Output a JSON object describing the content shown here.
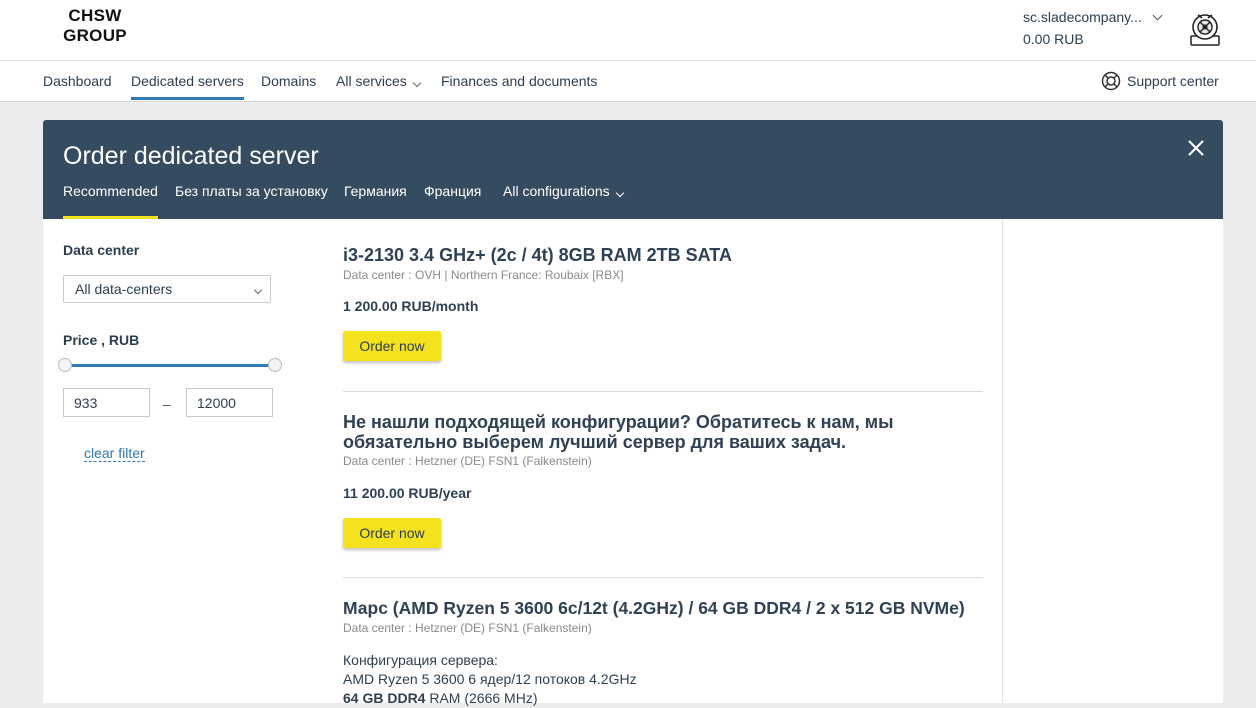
{
  "header": {
    "logo_line1": "CHSW",
    "logo_line2": "GROUP",
    "account_name": "sc.sladecompany...",
    "balance": "0.00 RUB"
  },
  "nav": {
    "items": [
      "Dashboard",
      "Dedicated servers",
      "Domains",
      "All services",
      "Finances and documents"
    ],
    "active": "Dedicated servers",
    "support": "Support center"
  },
  "panel": {
    "title": "Order dedicated server",
    "tabs": [
      "Recommended",
      "Без платы за установку",
      "Германия",
      "Франция",
      "All configurations"
    ],
    "active_tab": "Recommended"
  },
  "filters": {
    "datacenter_label": "Data center",
    "datacenter_value": "All data-centers",
    "price_label": "Price , RUB",
    "price_min": "933",
    "price_sep": "–",
    "price_max": "12000",
    "clear": "clear filter"
  },
  "offers": [
    {
      "title": "i3-2130 3.4 GHz+ (2c / 4t) 8GB RAM 2TB SATA",
      "dc": "Data center : OVH | Northern France: Roubaix [RBX]",
      "price": "1 200.00 RUB/month",
      "button": "Order now"
    },
    {
      "title": "Не нашли подходящей конфигурации? Обратитесь к нам, мы обязательно выберем лучший сервер для ваших задач.",
      "dc": "Data center : Hetzner (DE) FSN1 (Falkenstein)",
      "price": "11 200.00 RUB/year",
      "button": "Order now"
    },
    {
      "title": "Марс (AMD Ryzen 5 3600 6c/12t (4.2GHz) / 64 GB DDR4 / 2 x 512 GB NVMe)",
      "dc": "Data center : Hetzner (DE) FSN1 (Falkenstein)",
      "desc_line1": "Конфигурация сервера:",
      "desc_line2": "AMD Ryzen 5 3600 6 ядер/12 потоков 4.2GHz",
      "desc_line3_bold": "64 GB DDR4",
      "desc_line3_rest": " RAM (2666 MHz)"
    }
  ]
}
